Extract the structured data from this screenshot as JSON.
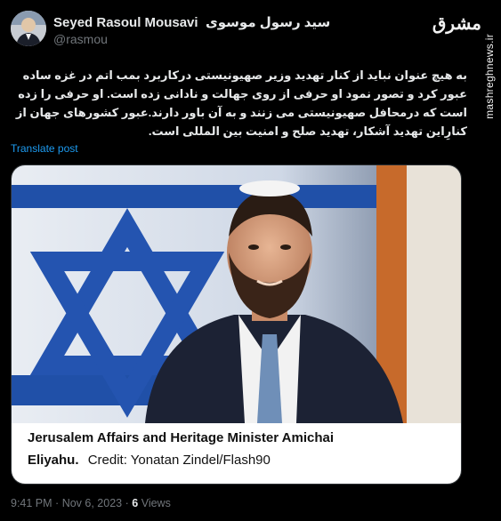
{
  "author": {
    "display_name": "Seyed Rasoul Mousavi",
    "display_name_fa": "سید رسول موسوی",
    "handle": "@rasmou"
  },
  "watermark": {
    "logo_text": "مشرق",
    "site": "mashreghnews.ir"
  },
  "tweet": {
    "text": "به هیچ عنوان نباید از کنار تهدید وزیر صهیونیستی درکاربرد بمب اتم در غزه ساده عبور کرد و تصور نمود او حرفی از روی جهالت و نادانی زده است. او حرفی را زده است که درمحافل صهیونیستی می زنند و به آن باور دارند.عبور کشورهای جهان از کنارِاین تهدید آشکار، تهدید صلح و امنیت بین المللی است.",
    "translate_label": "Translate post"
  },
  "card": {
    "caption_line1": "Jerusalem Affairs and Heritage Minister Amichai",
    "caption_name": "Eliyahu.",
    "caption_credit": "Credit: Yonatan Zindel/Flash90"
  },
  "meta": {
    "time": "9:41 PM",
    "date": "Nov 6, 2023",
    "views_count": "6",
    "views_label": "Views",
    "separator": "·"
  },
  "colors": {
    "background": "#000000",
    "text_primary": "#e7e9ea",
    "text_secondary": "#71767b",
    "link": "#1d9bf0",
    "flag_blue": "#1f4fa8"
  }
}
